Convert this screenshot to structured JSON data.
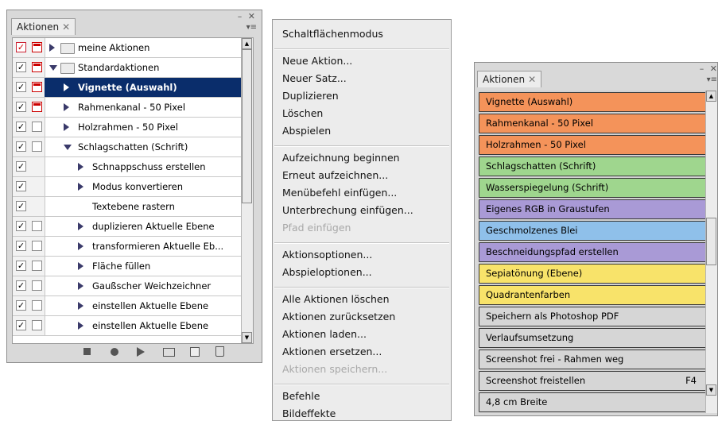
{
  "left_panel": {
    "tab_label": "Aktionen",
    "rows": [
      {
        "label": "meine Aktionen",
        "indent": 0,
        "toggle": "right",
        "folder": true,
        "check": "red",
        "dialog": "red",
        "selected": false
      },
      {
        "label": "Standardaktionen",
        "indent": 0,
        "toggle": "down",
        "folder": true,
        "check": "black",
        "dialog": "red",
        "selected": false
      },
      {
        "label": "Vignette (Auswahl)",
        "indent": 1,
        "toggle": "right",
        "folder": false,
        "check": "black",
        "dialog": "red",
        "selected": true
      },
      {
        "label": "Rahmenkanal - 50 Pixel",
        "indent": 1,
        "toggle": "right",
        "folder": false,
        "check": "black",
        "dialog": "red",
        "selected": false
      },
      {
        "label": "Holzrahmen - 50 Pixel",
        "indent": 1,
        "toggle": "right",
        "folder": false,
        "check": "black",
        "dialog": "empty",
        "selected": false
      },
      {
        "label": "Schlagschatten (Schrift)",
        "indent": 1,
        "toggle": "down",
        "folder": false,
        "check": "black",
        "dialog": "empty",
        "selected": false
      },
      {
        "label": "Schnappschuss erstellen",
        "indent": 2,
        "toggle": "right",
        "folder": false,
        "check": "black",
        "dialog": "none",
        "selected": false
      },
      {
        "label": "Modus konvertieren",
        "indent": 2,
        "toggle": "right",
        "folder": false,
        "check": "black",
        "dialog": "none",
        "selected": false
      },
      {
        "label": "Textebene rastern",
        "indent": 2,
        "toggle": "none",
        "folder": false,
        "check": "black",
        "dialog": "none",
        "selected": false
      },
      {
        "label": "duplizieren Aktuelle Ebene",
        "indent": 2,
        "toggle": "right",
        "folder": false,
        "check": "black",
        "dialog": "empty",
        "selected": false
      },
      {
        "label": "transformieren Aktuelle Eb...",
        "indent": 2,
        "toggle": "right",
        "folder": false,
        "check": "black",
        "dialog": "empty",
        "selected": false
      },
      {
        "label": "Fläche füllen",
        "indent": 2,
        "toggle": "right",
        "folder": false,
        "check": "black",
        "dialog": "empty",
        "selected": false
      },
      {
        "label": "Gaußscher Weichzeichner",
        "indent": 2,
        "toggle": "right",
        "folder": false,
        "check": "black",
        "dialog": "empty",
        "selected": false
      },
      {
        "label": "einstellen Aktuelle Ebene",
        "indent": 2,
        "toggle": "right",
        "folder": false,
        "check": "black",
        "dialog": "empty",
        "selected": false
      },
      {
        "label": "einstellen Aktuelle Ebene",
        "indent": 2,
        "toggle": "right",
        "folder": false,
        "check": "black",
        "dialog": "empty",
        "selected": false
      }
    ],
    "bottom_icons": [
      "stop-icon",
      "record-icon",
      "play-icon",
      "new-set-folder-icon",
      "new-action-icon",
      "trash-icon"
    ]
  },
  "context_menu": {
    "groups": [
      [
        {
          "label": "Schaltflächenmodus",
          "disabled": false
        }
      ],
      [
        {
          "label": "Neue Aktion...",
          "disabled": false
        },
        {
          "label": "Neuer Satz...",
          "disabled": false
        },
        {
          "label": "Duplizieren",
          "disabled": false
        },
        {
          "label": "Löschen",
          "disabled": false
        },
        {
          "label": "Abspielen",
          "disabled": false
        }
      ],
      [
        {
          "label": "Aufzeichnung beginnen",
          "disabled": false
        },
        {
          "label": "Erneut aufzeichnen...",
          "disabled": false
        },
        {
          "label": "Menübefehl einfügen...",
          "disabled": false
        },
        {
          "label": "Unterbrechung einfügen...",
          "disabled": false
        },
        {
          "label": "Pfad einfügen",
          "disabled": true
        }
      ],
      [
        {
          "label": "Aktionsoptionen...",
          "disabled": false
        },
        {
          "label": "Abspieloptionen...",
          "disabled": false
        }
      ],
      [
        {
          "label": "Alle Aktionen löschen",
          "disabled": false
        },
        {
          "label": "Aktionen zurücksetzen",
          "disabled": false
        },
        {
          "label": "Aktionen laden...",
          "disabled": false
        },
        {
          "label": "Aktionen ersetzen...",
          "disabled": false
        },
        {
          "label": "Aktionen speichern...",
          "disabled": true
        }
      ],
      [
        {
          "label": "Befehle",
          "disabled": false
        },
        {
          "label": "Bildeffekte",
          "disabled": false
        }
      ]
    ]
  },
  "right_panel": {
    "tab_label": "Aktionen",
    "buttons": [
      {
        "label": "Vignette (Auswahl)",
        "color": "#f4935a",
        "shortcut": ""
      },
      {
        "label": "Rahmenkanal - 50 Pixel",
        "color": "#f4935a",
        "shortcut": ""
      },
      {
        "label": "Holzrahmen - 50 Pixel",
        "color": "#f4935a",
        "shortcut": ""
      },
      {
        "label": "Schlagschatten (Schrift)",
        "color": "#9fd68e",
        "shortcut": ""
      },
      {
        "label": "Wasserspiegelung (Schrift)",
        "color": "#9fd68e",
        "shortcut": ""
      },
      {
        "label": "Eigenes RGB in Graustufen",
        "color": "#a99ad6",
        "shortcut": ""
      },
      {
        "label": "Geschmolzenes Blei",
        "color": "#8fc0ea",
        "shortcut": ""
      },
      {
        "label": "Beschneidungspfad erstellen",
        "color": "#a99ad6",
        "shortcut": ""
      },
      {
        "label": "Sepiatönung (Ebene)",
        "color": "#f8e36a",
        "shortcut": ""
      },
      {
        "label": "Quadrantenfarben",
        "color": "#f8e36a",
        "shortcut": ""
      },
      {
        "label": "Speichern als Photoshop PDF",
        "color": "#d6d6d6",
        "shortcut": ""
      },
      {
        "label": "Verlaufsumsetzung",
        "color": "#d6d6d6",
        "shortcut": ""
      },
      {
        "label": "Screenshot frei - Rahmen weg",
        "color": "#d6d6d6",
        "shortcut": ""
      },
      {
        "label": "Screenshot freistellen",
        "color": "#d6d6d6",
        "shortcut": "F4"
      },
      {
        "label": "4,8 cm Breite",
        "color": "#d6d6d6",
        "shortcut": ""
      }
    ]
  }
}
